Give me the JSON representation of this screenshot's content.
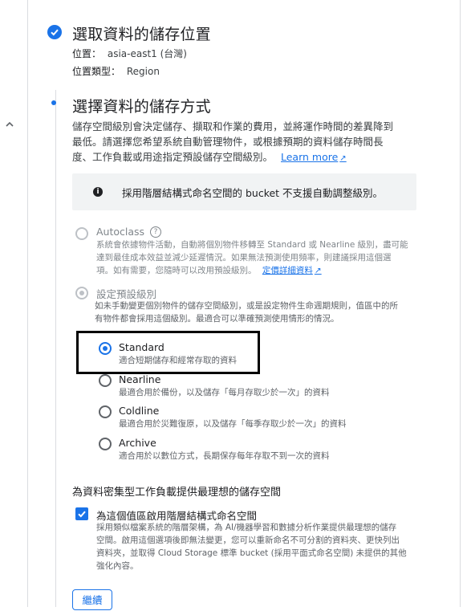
{
  "step1": {
    "title": "選取資料的儲存位置",
    "location_label": "位置：",
    "location_value": "asia-east1 (台灣)",
    "location_type_label": "位置類型：",
    "location_type_value": "Region"
  },
  "step2": {
    "title": "選擇資料的儲存方式",
    "description_line1": "儲存空間級別會決定儲存、擷取和作業的費用，並將運作時間的差異降到",
    "description_line2": "最低。請選擇您希望系統自動管理物件，或根據預期的資料儲存時間長",
    "description_line3": "度、工作負載或用途指定預設儲存空間級別。",
    "learn_more": "Learn more",
    "info_text": "採用階層結構式命名空間的 bucket 不支援自動調整級別。",
    "autoclass": {
      "label": "Autoclass",
      "sub1": "系統會依據物件活動，自動將個別物件移轉至 Standard 或 Nearline 級別，盡可能",
      "sub2": "達到最佳成本效益並減少延遲情況。如果無法預測使用頻率，則建議採用這個選",
      "sub3_prefix": "項。如有需要，您隨時可以改用預設級別。",
      "pricing_link": "定價詳細資料"
    },
    "default_class": {
      "label": "設定預設級別",
      "sub1": "如未手動變更個別物件的儲存空間級別，或是設定物件生命週期規則，值區中的所",
      "sub2": "有物件都會採用這個級別。最適合可以準確預測使用情形的情況。"
    },
    "classes": [
      {
        "label": "Standard",
        "sub": "適合短期儲存和經常存取的資料"
      },
      {
        "label": "Nearline",
        "sub": "最適合用於備份，以及儲存「每月存取少於一次」的資料"
      },
      {
        "label": "Coldline",
        "sub": "最適合用於災難復原，以及儲存「每季存取少於一次」的資料"
      },
      {
        "label": "Archive",
        "sub": "適合用於以數位方式，長期保存每年存取不到一次的資料"
      }
    ],
    "hns": {
      "heading": "為資料密集型工作負載提供最理想的儲存空間",
      "checkbox_label": "為這個值區啟用階層結構式命名空間",
      "sub1": "採用類似檔案系統的階層架構，為 AI/機器學習和數據分析作業提供最理想的儲存",
      "sub2": "空間。啟用這個選項後即無法變更，您可以重新命名不可分割的資料夾、更快列出",
      "sub3": "資料夾，並取得 Cloud Storage 標準 bucket (採用平面式命名空間) 未提供的其他",
      "sub4": "強化內容。"
    },
    "continue_label": "繼續"
  },
  "colors": {
    "accent": "#1a73e8",
    "highlight_box": "#000000"
  },
  "icons": [
    "check-circle-icon",
    "info-icon",
    "help-icon",
    "external-link-icon",
    "chevron-up-icon",
    "checkbox-checked-icon"
  ]
}
